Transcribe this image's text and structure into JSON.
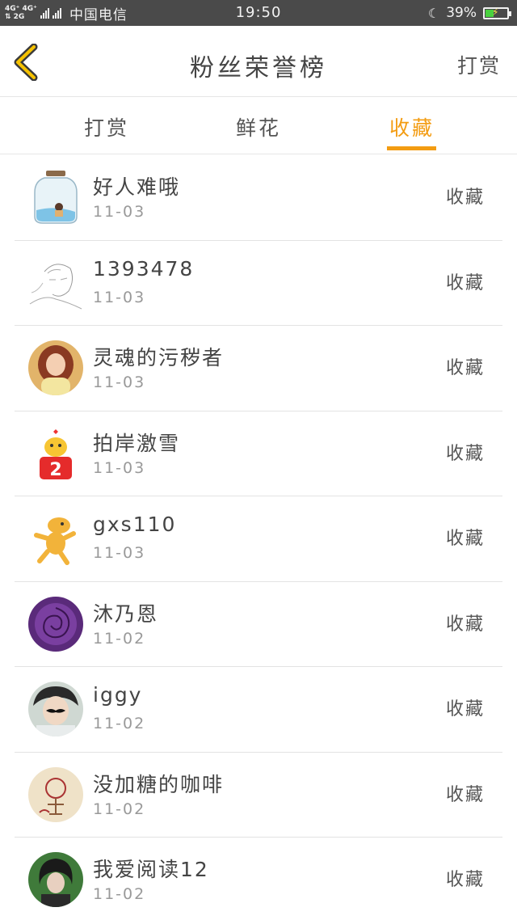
{
  "status_bar": {
    "network_top": "4G⁺ 4G⁺",
    "network_bottom": "⇅ 2G",
    "carrier": "中国电信",
    "time": "19:50",
    "battery": "39%",
    "battery_level": 0.39,
    "battery_color": "#49d13f"
  },
  "header": {
    "title": "粉丝荣誉榜",
    "action": "打赏",
    "accent_color": "#f39c12"
  },
  "tabs": [
    {
      "label": "打赏",
      "active": false
    },
    {
      "label": "鲜花",
      "active": false
    },
    {
      "label": "收藏",
      "active": true
    }
  ],
  "list": [
    {
      "name": "好人难哦",
      "date": "11-03",
      "action": "收藏",
      "avatar": "jar-avatar"
    },
    {
      "name": "1393478",
      "date": "11-03",
      "action": "收藏",
      "avatar": "sketch-avatar"
    },
    {
      "name": "灵魂的污秽者",
      "date": "11-03",
      "action": "收藏",
      "avatar": "girl-avatar"
    },
    {
      "name": "拍岸激雪",
      "date": "11-03",
      "action": "收藏",
      "avatar": "emoji-avatar"
    },
    {
      "name": "gxs110",
      "date": "11-03",
      "action": "收藏",
      "avatar": "cartoon-avatar"
    },
    {
      "name": "沐乃恩",
      "date": "11-02",
      "action": "收藏",
      "avatar": "rose-avatar"
    },
    {
      "name": "iggy",
      "date": "11-02",
      "action": "收藏",
      "avatar": "mustache-avatar"
    },
    {
      "name": "没加糖的咖啡",
      "date": "11-02",
      "action": "收藏",
      "avatar": "drawing-avatar"
    },
    {
      "name": "我爱阅读12",
      "date": "11-02",
      "action": "收藏",
      "avatar": "person-avatar"
    }
  ]
}
